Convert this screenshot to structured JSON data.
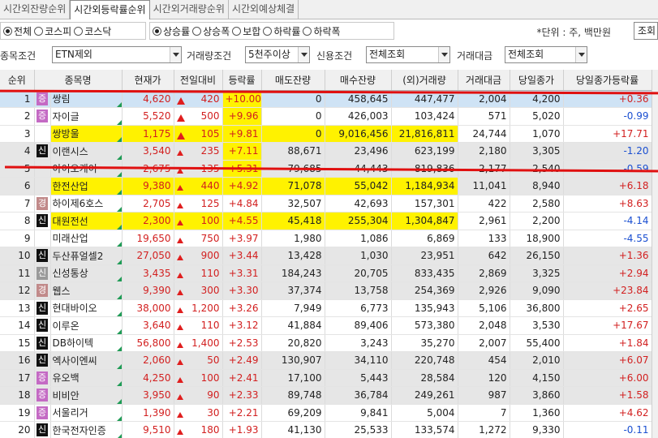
{
  "tabs": [
    "시간외잔량순위",
    "시간외등락률순위",
    "시간외거래량순위",
    "시간외예상체결"
  ],
  "market_options": [
    {
      "label": "전체",
      "on": true
    },
    {
      "label": "코스피",
      "on": false
    },
    {
      "label": "코스닥",
      "on": false
    }
  ],
  "sort_options": [
    {
      "label": "상승률",
      "on": true
    },
    {
      "label": "상승폭",
      "on": false
    },
    {
      "label": "보합",
      "on": false
    },
    {
      "label": "하락률",
      "on": false
    },
    {
      "label": "하락폭",
      "on": false
    }
  ],
  "unit_text": "*단위 : 주, 백만원",
  "query_button": "조회",
  "filters": {
    "stock_cond_label": "종목조건",
    "stock_cond_value": "ETN제외",
    "volume_cond_label": "거래량조건",
    "volume_cond_value": "5천주이상",
    "credit_cond_label": "신용조건",
    "credit_cond_value": "전체조회",
    "amount_label": "거래대금",
    "amount_value": "전체조회"
  },
  "columns": [
    "순위",
    "종목명",
    "현재가",
    "전일대비",
    "등락률",
    "매도잔량",
    "매수잔량",
    "(외)거래량",
    "거래대금",
    "당일종가",
    "당일종가등락률"
  ],
  "rows": [
    {
      "rank": "1",
      "badge": "증",
      "bt": "jeung",
      "name": "쌍림",
      "price": "4,620",
      "arrow": "big",
      "chg": "420",
      "rate": "+10.00",
      "sell": "0",
      "buy": "458,645",
      "vol": "447,477",
      "amt": "2,004",
      "close": "4,200",
      "crate": "+0.36",
      "cdir": "up",
      "row": "sel",
      "hl": [
        "rate"
      ]
    },
    {
      "rank": "2",
      "badge": "증",
      "bt": "jeung",
      "name": "자이글",
      "price": "5,520",
      "arrow": "big",
      "chg": "500",
      "rate": "+9.96",
      "sell": "0",
      "buy": "426,003",
      "vol": "103,424",
      "amt": "571",
      "close": "5,020",
      "crate": "-0.99",
      "cdir": "down",
      "row": "",
      "hl": [
        "rate"
      ]
    },
    {
      "rank": "3",
      "badge": "",
      "bt": "",
      "name": "쌍방울",
      "price": "1,175",
      "arrow": "big",
      "chg": "105",
      "rate": "+9.81",
      "sell": "0",
      "buy": "9,016,456",
      "vol": "21,816,811",
      "amt": "24,744",
      "close": "1,070",
      "crate": "+17.71",
      "cdir": "up",
      "row": "",
      "hl": [
        "name",
        "price",
        "chg",
        "rate",
        "sell",
        "buy",
        "vol"
      ]
    },
    {
      "rank": "4",
      "badge": "신",
      "bt": "shin",
      "name": "이랜시스",
      "price": "3,540",
      "arrow": "tri",
      "chg": "235",
      "rate": "+7.11",
      "sell": "88,671",
      "buy": "23,496",
      "vol": "623,199",
      "amt": "2,180",
      "close": "3,305",
      "crate": "-1.20",
      "cdir": "down",
      "row": "grey",
      "hl": [
        "rate"
      ]
    },
    {
      "rank": "5",
      "badge": "",
      "bt": "",
      "name": "아이오케이",
      "price": "2,675",
      "arrow": "tri",
      "chg": "135",
      "rate": "+5.31",
      "sell": "79,685",
      "buy": "44,443",
      "vol": "819,836",
      "amt": "2,177",
      "close": "2,540",
      "crate": "-0.59",
      "cdir": "down",
      "row": "grey",
      "hl": [
        "rate"
      ]
    },
    {
      "rank": "6",
      "badge": "",
      "bt": "",
      "name": "한전산업",
      "price": "9,380",
      "arrow": "tri",
      "chg": "440",
      "rate": "+4.92",
      "sell": "71,078",
      "buy": "55,042",
      "vol": "1,184,934",
      "amt": "11,041",
      "close": "8,940",
      "crate": "+6.18",
      "cdir": "up",
      "row": "grey",
      "hl": [
        "name",
        "price",
        "chg",
        "rate",
        "sell",
        "buy",
        "vol"
      ]
    },
    {
      "rank": "7",
      "badge": "경",
      "bt": "gyeong",
      "name": "하이제6호스",
      "price": "2,705",
      "arrow": "tri",
      "chg": "125",
      "rate": "+4.84",
      "sell": "32,507",
      "buy": "42,693",
      "vol": "157,301",
      "amt": "422",
      "close": "2,580",
      "crate": "+8.63",
      "cdir": "up",
      "row": "",
      "hl": []
    },
    {
      "rank": "8",
      "badge": "신",
      "bt": "shin",
      "name": "대원전선",
      "price": "2,300",
      "arrow": "tri",
      "chg": "100",
      "rate": "+4.55",
      "sell": "45,418",
      "buy": "255,304",
      "vol": "1,304,847",
      "amt": "2,961",
      "close": "2,200",
      "crate": "-4.14",
      "cdir": "down",
      "row": "",
      "hl": [
        "name",
        "price",
        "chg",
        "rate",
        "sell",
        "buy",
        "vol"
      ]
    },
    {
      "rank": "9",
      "badge": "",
      "bt": "",
      "name": "미래산업",
      "price": "19,650",
      "arrow": "tri",
      "chg": "750",
      "rate": "+3.97",
      "sell": "1,980",
      "buy": "1,086",
      "vol": "6,869",
      "amt": "133",
      "close": "18,900",
      "crate": "-4.55",
      "cdir": "down",
      "row": "",
      "hl": []
    },
    {
      "rank": "10",
      "badge": "신",
      "bt": "shin",
      "name": "두산퓨얼셀2",
      "price": "27,050",
      "arrow": "tri",
      "chg": "900",
      "rate": "+3.44",
      "sell": "13,428",
      "buy": "1,030",
      "vol": "23,951",
      "amt": "642",
      "close": "26,150",
      "crate": "+1.36",
      "cdir": "up",
      "row": "grey",
      "hl": []
    },
    {
      "rank": "11",
      "badge": "신",
      "bt": "shin2",
      "name": "신성통상",
      "price": "3,435",
      "arrow": "tri",
      "chg": "110",
      "rate": "+3.31",
      "sell": "184,243",
      "buy": "20,705",
      "vol": "833,435",
      "amt": "2,869",
      "close": "3,325",
      "crate": "+2.94",
      "cdir": "up",
      "row": "grey",
      "hl": []
    },
    {
      "rank": "12",
      "badge": "경",
      "bt": "gyeong",
      "name": "웹스",
      "price": "9,390",
      "arrow": "tri",
      "chg": "300",
      "rate": "+3.30",
      "sell": "37,374",
      "buy": "13,758",
      "vol": "254,369",
      "amt": "2,926",
      "close": "9,090",
      "crate": "+23.84",
      "cdir": "up",
      "row": "grey",
      "hl": []
    },
    {
      "rank": "13",
      "badge": "신",
      "bt": "shin",
      "name": "현대바이오",
      "price": "38,000",
      "arrow": "tri",
      "chg": "1,200",
      "rate": "+3.26",
      "sell": "7,949",
      "buy": "6,773",
      "vol": "135,943",
      "amt": "5,106",
      "close": "36,800",
      "crate": "+2.65",
      "cdir": "up",
      "row": "",
      "hl": []
    },
    {
      "rank": "14",
      "badge": "신",
      "bt": "shin",
      "name": "이루온",
      "price": "3,640",
      "arrow": "tri",
      "chg": "110",
      "rate": "+3.12",
      "sell": "41,884",
      "buy": "89,406",
      "vol": "573,380",
      "amt": "2,048",
      "close": "3,530",
      "crate": "+17.67",
      "cdir": "up",
      "row": "",
      "hl": []
    },
    {
      "rank": "15",
      "badge": "신",
      "bt": "shin",
      "name": "DB하이텍",
      "price": "56,800",
      "arrow": "tri",
      "chg": "1,400",
      "rate": "+2.53",
      "sell": "20,820",
      "buy": "3,243",
      "vol": "35,270",
      "amt": "2,007",
      "close": "55,400",
      "crate": "+1.84",
      "cdir": "up",
      "row": "",
      "hl": []
    },
    {
      "rank": "16",
      "badge": "신",
      "bt": "shin",
      "name": "엑사이엔씨",
      "price": "2,060",
      "arrow": "tri",
      "chg": "50",
      "rate": "+2.49",
      "sell": "130,907",
      "buy": "34,110",
      "vol": "220,748",
      "amt": "454",
      "close": "2,010",
      "crate": "+6.07",
      "cdir": "up",
      "row": "grey",
      "hl": []
    },
    {
      "rank": "17",
      "badge": "증",
      "bt": "jeung",
      "name": "유오백",
      "price": "4,250",
      "arrow": "tri",
      "chg": "100",
      "rate": "+2.41",
      "sell": "17,100",
      "buy": "5,443",
      "vol": "28,584",
      "amt": "120",
      "close": "4,150",
      "crate": "+6.00",
      "cdir": "up",
      "row": "grey",
      "hl": []
    },
    {
      "rank": "18",
      "badge": "증",
      "bt": "jeung",
      "name": "비비안",
      "price": "3,950",
      "arrow": "tri",
      "chg": "90",
      "rate": "+2.33",
      "sell": "89,748",
      "buy": "36,784",
      "vol": "249,261",
      "amt": "987",
      "close": "3,860",
      "crate": "+1.58",
      "cdir": "up",
      "row": "grey",
      "hl": []
    },
    {
      "rank": "19",
      "badge": "증",
      "bt": "jeung",
      "name": "서울리거",
      "price": "1,390",
      "arrow": "tri",
      "chg": "30",
      "rate": "+2.21",
      "sell": "69,209",
      "buy": "9,841",
      "vol": "5,004",
      "amt": "7",
      "close": "1,360",
      "crate": "+4.62",
      "cdir": "up",
      "row": "",
      "hl": []
    },
    {
      "rank": "20",
      "badge": "신",
      "bt": "shin",
      "name": "한국전자인증",
      "price": "9,510",
      "arrow": "tri",
      "chg": "180",
      "rate": "+1.93",
      "sell": "41,130",
      "buy": "25,533",
      "vol": "133,574",
      "amt": "1,272",
      "close": "9,330",
      "crate": "-0.11",
      "cdir": "down",
      "row": "",
      "hl": []
    }
  ],
  "colors": {
    "up": "#d21f1f",
    "down": "#1a4fd1",
    "highlight": "#fff200",
    "annotation": "#e01010"
  }
}
